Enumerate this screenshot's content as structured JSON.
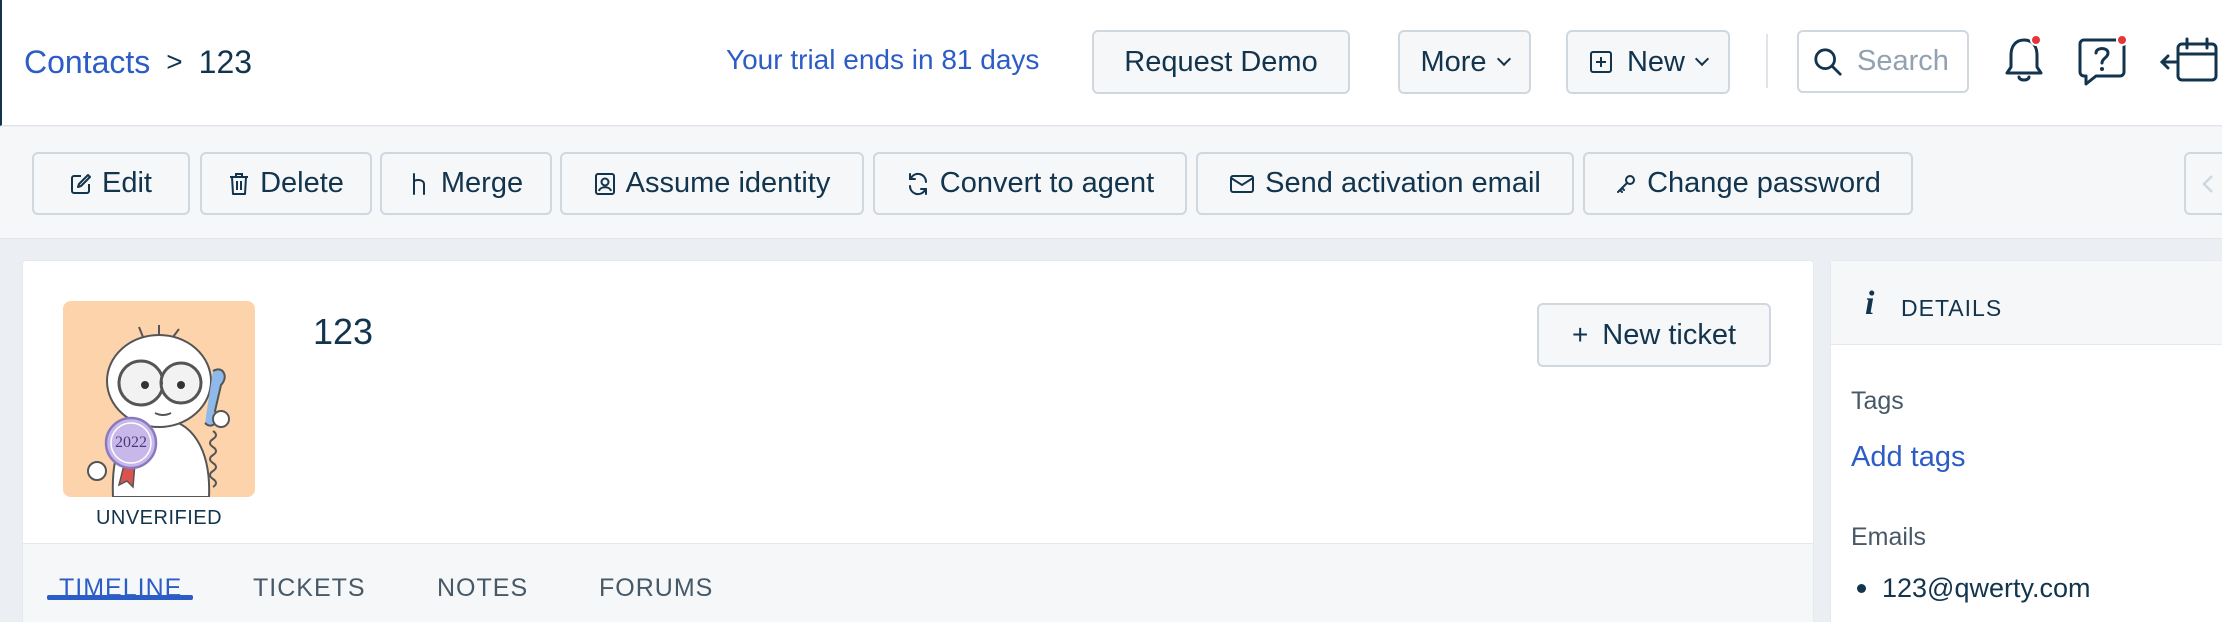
{
  "header": {
    "breadcrumb": {
      "parent": "Contacts",
      "separator": ">",
      "current": "123"
    },
    "trial_text": "Your trial ends in 81 days",
    "request_demo_label": "Request Demo",
    "more_label": "More",
    "new_label": "New",
    "search_placeholder": "Search",
    "icons": [
      "notification-bell-icon",
      "help-icon",
      "calendar-collapse-icon"
    ]
  },
  "toolbar": {
    "edit": "Edit",
    "delete": "Delete",
    "merge": "Merge",
    "assume_identity": "Assume identity",
    "convert_to_agent": "Convert to agent",
    "send_activation_email": "Send activation email",
    "change_password": "Change password"
  },
  "contact": {
    "name": "123",
    "status": "UNVERIFIED",
    "new_ticket_label": "New ticket",
    "new_ticket_prefix": "+"
  },
  "tabs": [
    {
      "label": "TIMELINE",
      "active": true
    },
    {
      "label": "TICKETS",
      "active": false
    },
    {
      "label": "NOTES",
      "active": false
    },
    {
      "label": "FORUMS",
      "active": false
    }
  ],
  "details": {
    "title": "DETAILS",
    "tags_label": "Tags",
    "add_tags_label": "Add tags",
    "emails_label": "Emails",
    "emails": [
      "123@qwerty.com"
    ]
  },
  "avatar": {
    "badge_text": "2022"
  },
  "colors": {
    "accent": "#2c5cc5",
    "text": "#12344d",
    "notification_dot": "#e43538",
    "avatar_bg": "#fdd3ac"
  }
}
